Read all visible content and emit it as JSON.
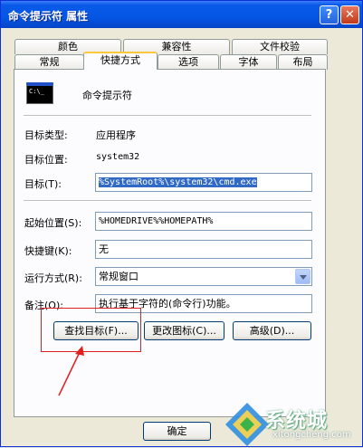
{
  "window": {
    "title": "命令提示符 属性",
    "help_label": "?",
    "close_label": "✕"
  },
  "tabs_top": [
    {
      "label": "颜色"
    },
    {
      "label": "兼容性"
    },
    {
      "label": "文件校验"
    }
  ],
  "tabs_bottom": [
    {
      "label": "常规"
    },
    {
      "label": "快捷方式",
      "active": true
    },
    {
      "label": "选项"
    },
    {
      "label": "字体"
    },
    {
      "label": "布局"
    }
  ],
  "shortcut": {
    "app_name": "命令提示符",
    "icon_text": "C:\\_",
    "target_type_label": "目标类型:",
    "target_type_value": "应用程序",
    "target_location_label": "目标位置:",
    "target_location_value": "system32",
    "target_label": "目标(T):",
    "target_value": "%SystemRoot%\\system32\\cmd.exe",
    "start_in_label": "起始位置(S):",
    "start_in_value": "%HOMEDRIVE%%HOMEPATH%",
    "hotkey_label": "快捷键(K):",
    "hotkey_value": "无",
    "run_label": "运行方式(R):",
    "run_value": "常规窗口",
    "comment_label": "备注(O):",
    "comment_value": "执行基于字符的(命令行)功能。"
  },
  "buttons": {
    "find_target": "查找目标(F)...",
    "change_icon": "更改图标(C)...",
    "advanced": "高级(D)...",
    "ok": "确定"
  },
  "watermark": {
    "text": "系统城",
    "url": "xitongcheng.com"
  }
}
